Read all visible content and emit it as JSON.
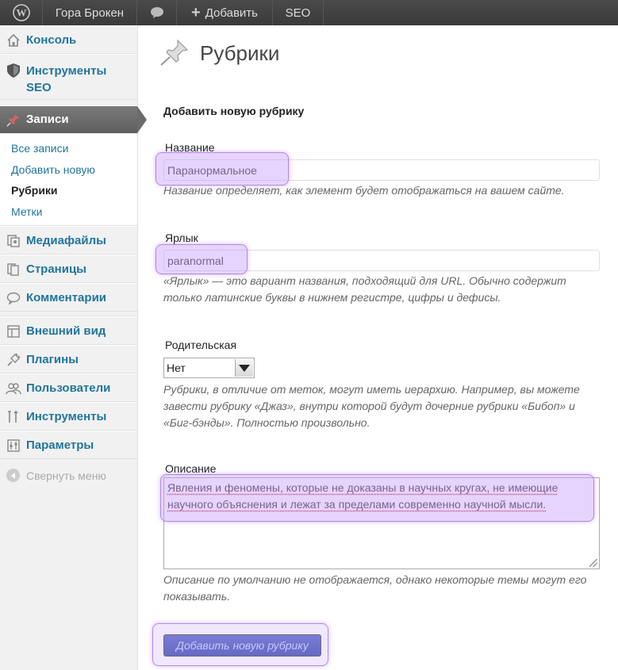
{
  "admin_bar": {
    "wp_logo": "wordpress-icon",
    "site_name": "Гора Брокен",
    "comments_icon": "comment-bubble-icon",
    "new_label": "Добавить",
    "seo_label": "SEO"
  },
  "sidebar": {
    "console": "Консоль",
    "tools_seo_line1": "Инструменты",
    "tools_seo_line2": "SEO",
    "posts": "Записи",
    "submenu": {
      "all_posts": "Все записи",
      "add_new": "Добавить новую",
      "categories": "Рубрики",
      "tags": "Метки"
    },
    "media": "Медиафайлы",
    "pages": "Страницы",
    "comments": "Комментарии",
    "appearance": "Внешний вид",
    "plugins": "Плагины",
    "users": "Пользователи",
    "tools": "Инструменты",
    "settings": "Параметры",
    "collapse": "Свернуть меню"
  },
  "main": {
    "title": "Рубрики",
    "section_heading": "Добавить новую рубрику",
    "name": {
      "label": "Название",
      "value": "Паранормальное",
      "hint": "Название определяет, как элемент будет отображаться на вашем сайте."
    },
    "slug": {
      "label": "Ярлык",
      "value": "paranormal",
      "hint_line1": "«Ярлык» — это вариант названия, подходящий для URL. Обычно содержит",
      "hint_line2": "только латинские буквы в нижнем регистре, цифры и дефисы."
    },
    "parent": {
      "label": "Родительская",
      "selected": "Нет",
      "hint_line1": "Рубрики, в отличие от меток, могут иметь иерархию. Например, вы можете",
      "hint_line2": "завести рубрику «Джаз», внутри которой будут дочерние рубрики «Бибоп» и",
      "hint_line3": "«Биг-бэнды». Полностью произвольно."
    },
    "description": {
      "label": "Описание",
      "value_line1": "Явления и феномены, которые не доказаны в научных кругах, не имеющие",
      "value_line2": "научного объяснения и лежат за пределами современно научной мысли.",
      "hint_line1": "Описание по умолчанию не отображается, однако некоторые темы могут его",
      "hint_line2": "показывать."
    },
    "submit_label": "Добавить новую рубрику"
  }
}
